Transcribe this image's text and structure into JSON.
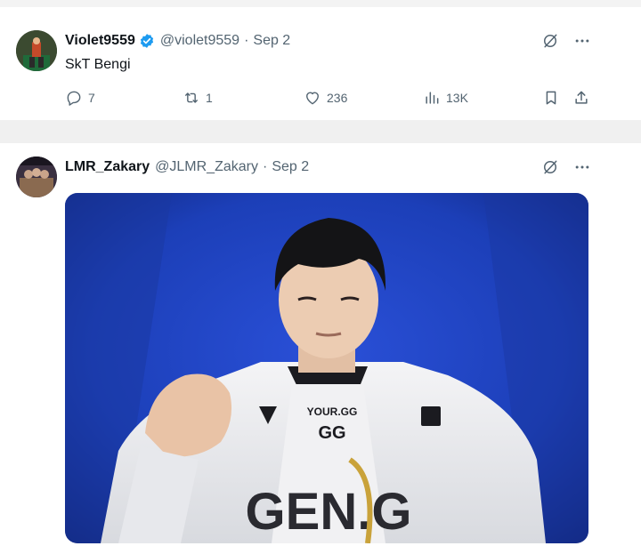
{
  "tweets": [
    {
      "name": "Violet9559",
      "verified": true,
      "handle": "@violet9559",
      "separator": "·",
      "date": "Sep 2",
      "text": "SkT Bengi",
      "stats": {
        "replies": "7",
        "retweets": "1",
        "likes": "236",
        "views": "13K"
      }
    },
    {
      "name": "LMR_Zakary",
      "handle": "@JLMR_Zakary",
      "separator": "·",
      "date": "Sep 2",
      "media": {
        "jersey_top": "YOUR.GG",
        "jersey_logo": "GG",
        "jersey_sponsor": "GEN.G"
      }
    }
  ],
  "colors": {
    "verified": "#1d9bf0",
    "muted": "#536471",
    "text": "#0f1419",
    "photo_bg": "#1c3fb8"
  },
  "icons": [
    "grok-icon",
    "more-icon",
    "reply-icon",
    "retweet-icon",
    "like-icon",
    "views-icon",
    "bookmark-icon",
    "share-icon",
    "verified-badge-icon"
  ]
}
